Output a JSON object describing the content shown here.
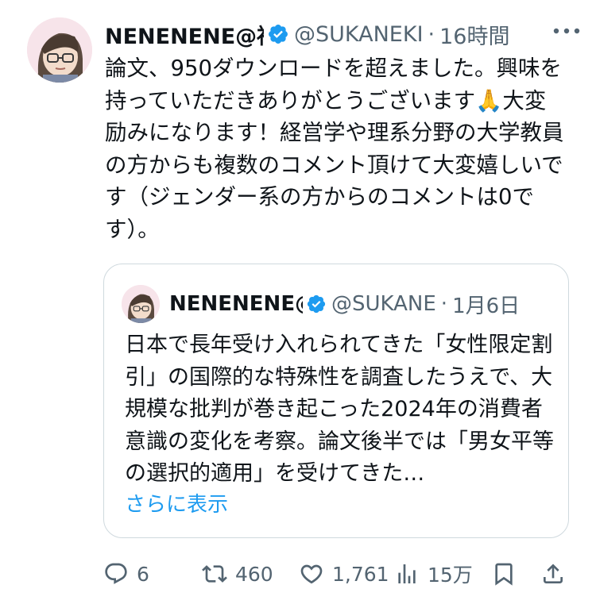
{
  "tweet": {
    "display_name": "NENENENE@福",
    "handle": "@SUKANEKI",
    "separator": "·",
    "time": "16時間",
    "text": "論文、950ダウンロードを超えました。興味を持っていただきありがとうございます🙏大変励みになります！経営学や理系分野の大学教員の方からも複数のコメント頂けて大変嬉しいです（ジェンダー系の方からのコメントは0です）。",
    "icons": {
      "avatar": "avatar",
      "verified": "verified-badge-icon",
      "more": "more-icon"
    },
    "colors": {
      "verified": "#1d9bf0",
      "secondary_text": "#536471",
      "link": "#1d9bf0"
    }
  },
  "quote": {
    "display_name": "NENENENE@",
    "handle": "@SUKANE",
    "separator": "·",
    "date": "1月6日",
    "text": "日本で長年受け入れられてきた「女性限定割引」の国際的な特殊性を調査したうえで、大規模な批判が巻き起こった2024年の消費者意識の変化を考察。論文後半では「男女平等の選択的適用」を受けてきた…",
    "show_more": "さらに表示"
  },
  "actions": {
    "reply": {
      "icon": "reply-icon",
      "count": "6"
    },
    "repost": {
      "icon": "repost-icon",
      "count": "460"
    },
    "like": {
      "icon": "like-icon",
      "count": "1,761"
    },
    "views": {
      "icon": "views-icon",
      "count": "15万"
    },
    "bookmark": {
      "icon": "bookmark-icon"
    },
    "share": {
      "icon": "share-icon"
    }
  }
}
